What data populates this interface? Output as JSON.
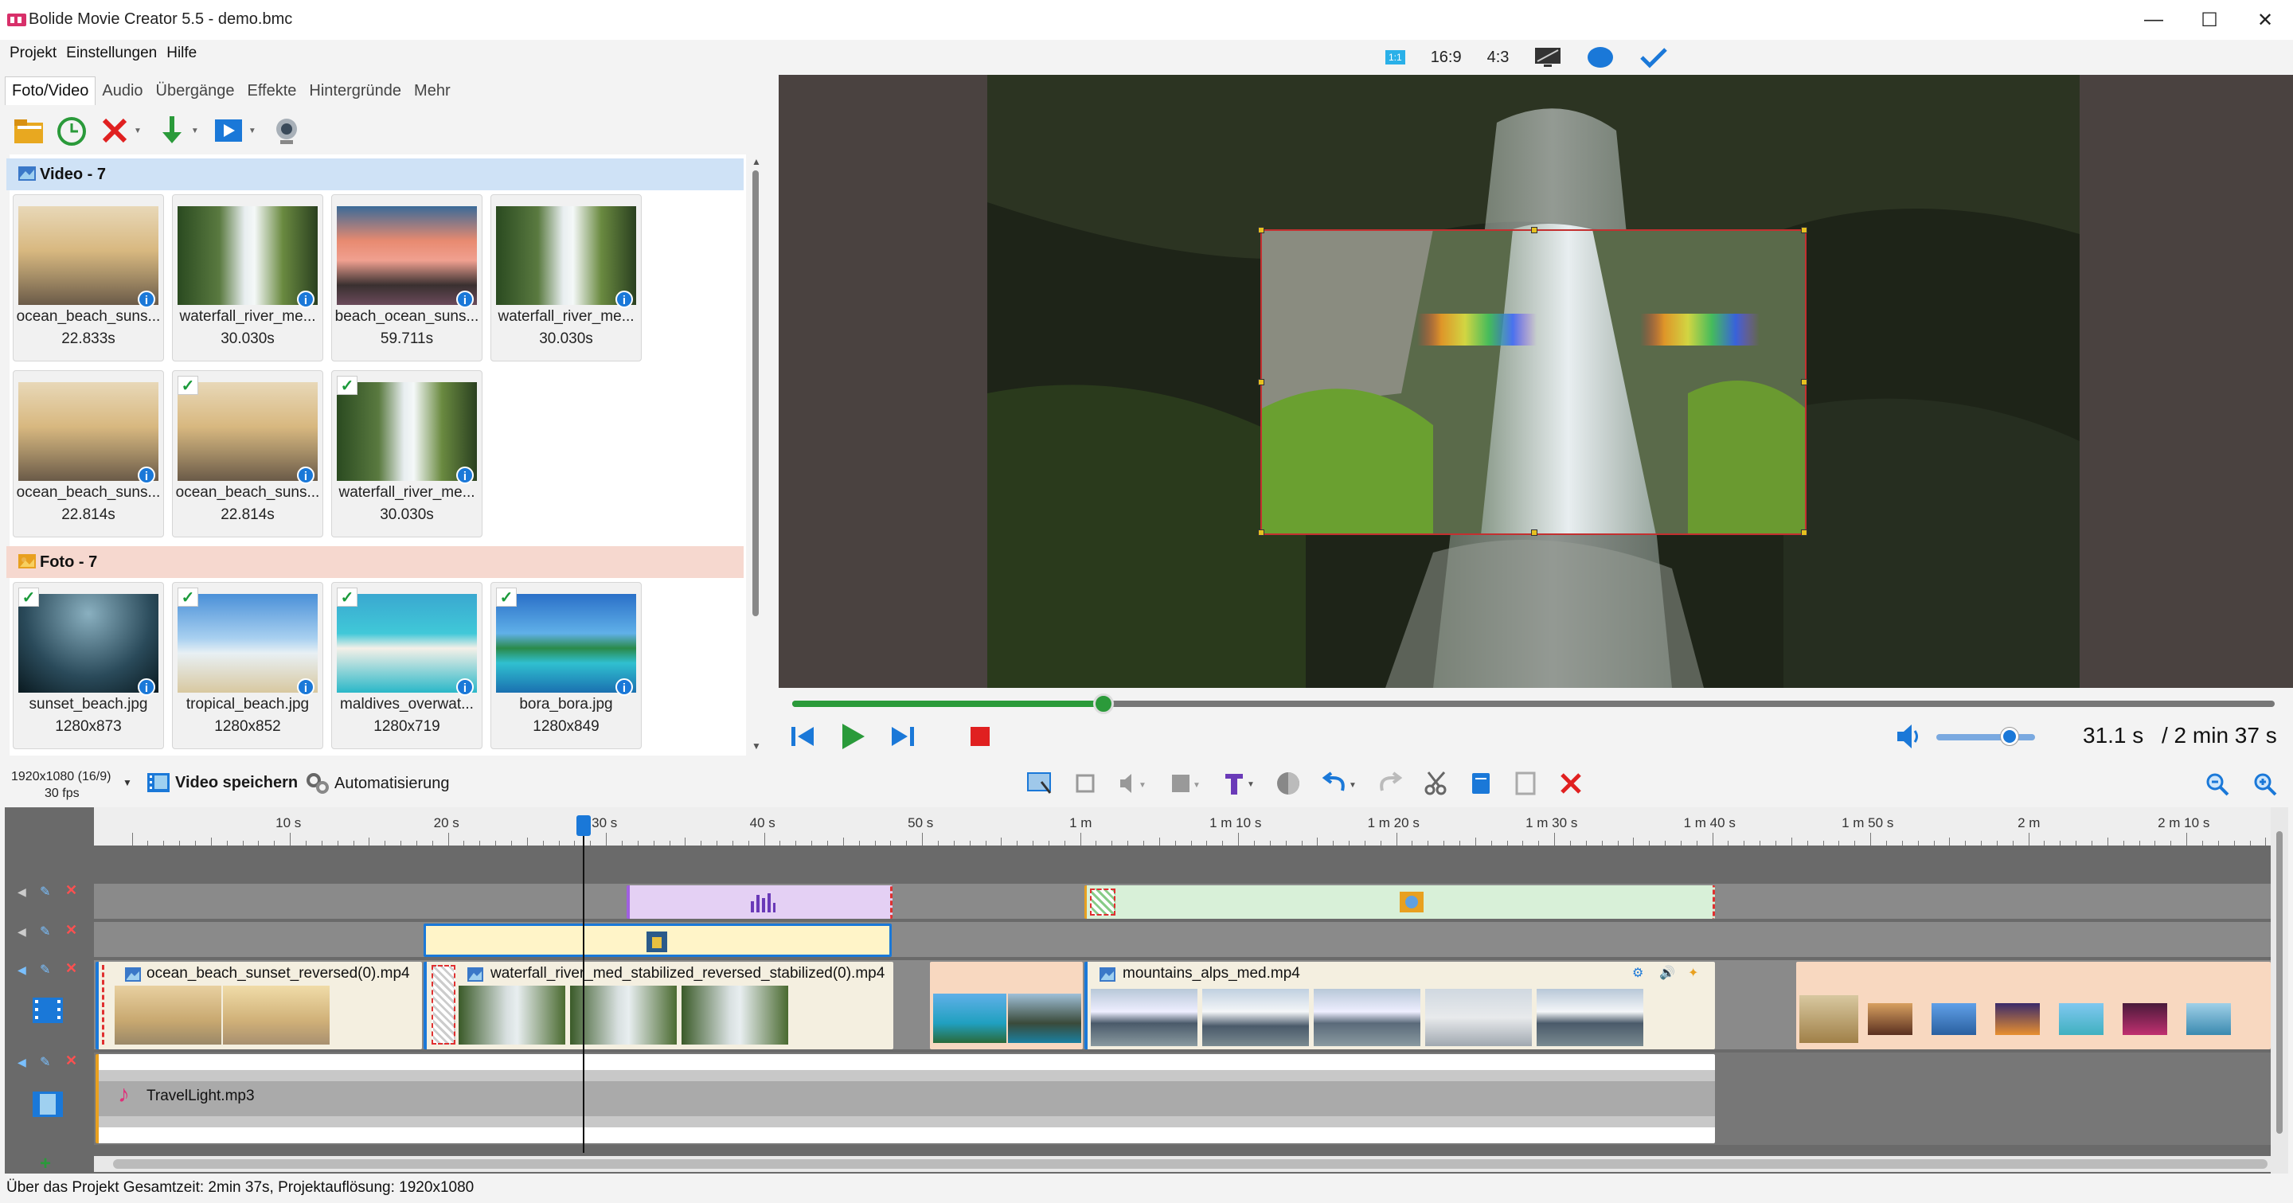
{
  "window": {
    "title": "Bolide Movie Creator 5.5 - demo.bmc",
    "minimize": "—",
    "maximize": "☐",
    "close": "✕"
  },
  "menu": [
    "Projekt",
    "Einstellungen",
    "Hilfe"
  ],
  "tabs": [
    "Foto/Video",
    "Audio",
    "Übergänge",
    "Effekte",
    "Hintergründe",
    "Mehr"
  ],
  "aspect": {
    "ratio_a": "16:9",
    "ratio_b": "4:3",
    "badge": "1:1"
  },
  "library": {
    "video_header": "Video - 7",
    "photo_header": "Foto - 7",
    "videos": [
      {
        "name": "ocean_beach_suns...",
        "meta": "22.833s",
        "checked": false,
        "thumb": "sunset"
      },
      {
        "name": "waterfall_river_me...",
        "meta": "30.030s",
        "checked": false,
        "thumb": "waterfall"
      },
      {
        "name": "beach_ocean_suns...",
        "meta": "59.711s",
        "checked": false,
        "thumb": "pink"
      },
      {
        "name": "waterfall_river_me...",
        "meta": "30.030s",
        "checked": false,
        "thumb": "waterfall"
      },
      {
        "name": "ocean_beach_suns...",
        "meta": "22.814s",
        "checked": false,
        "thumb": "sunset"
      },
      {
        "name": "ocean_beach_suns...",
        "meta": "22.814s",
        "checked": true,
        "thumb": "sunset"
      },
      {
        "name": "waterfall_river_me...",
        "meta": "30.030s",
        "checked": true,
        "thumb": "waterfall"
      }
    ],
    "photos": [
      {
        "name": "sunset_beach.jpg",
        "meta": "1280x873",
        "checked": true,
        "thumb": "elephant"
      },
      {
        "name": "tropical_beach.jpg",
        "meta": "1280x852",
        "checked": true,
        "thumb": "sky"
      },
      {
        "name": "maldives_overwat...",
        "meta": "1280x719",
        "checked": true,
        "thumb": "maldives"
      },
      {
        "name": "bora_bora.jpg",
        "meta": "1280x849",
        "checked": true,
        "thumb": "island"
      }
    ]
  },
  "player": {
    "progress": 0.21,
    "volume": 0.74,
    "time_current": "31.1 s",
    "time_total": "/ 2 min 37 s"
  },
  "bottom_toolbar": {
    "resolution": "1920x1080 (16/9)",
    "fps": "30 fps",
    "save_video": "Video speichern",
    "automation": "Automatisierung"
  },
  "ruler_labels": [
    "10 s",
    "20 s",
    "30 s",
    "40 s",
    "50 s",
    "1 m",
    "1 m 10 s",
    "1 m 20 s",
    "1 m 30 s",
    "1 m 40 s",
    "1 m 50 s",
    "2 m",
    "2 m 10 s"
  ],
  "clips": {
    "video1": "ocean_beach_sunset_reversed(0).mp4",
    "video2": "waterfall_river_med_stabilized_reversed_stabilized(0).mp4",
    "video3": "mountains_alps_med.mp4",
    "audio": "TravelLight.mp3"
  },
  "status": {
    "text": "Über das Projekt Gesamtzeit: 2min 37s,   Projektauflösung:   1920x1080"
  },
  "colors": {
    "accent": "#1a78d8",
    "progress": "#2b9a3a",
    "video_header_bg": "#cfe2f6",
    "photo_header_bg": "#f6d8cf",
    "delete_red": "#e02020"
  }
}
